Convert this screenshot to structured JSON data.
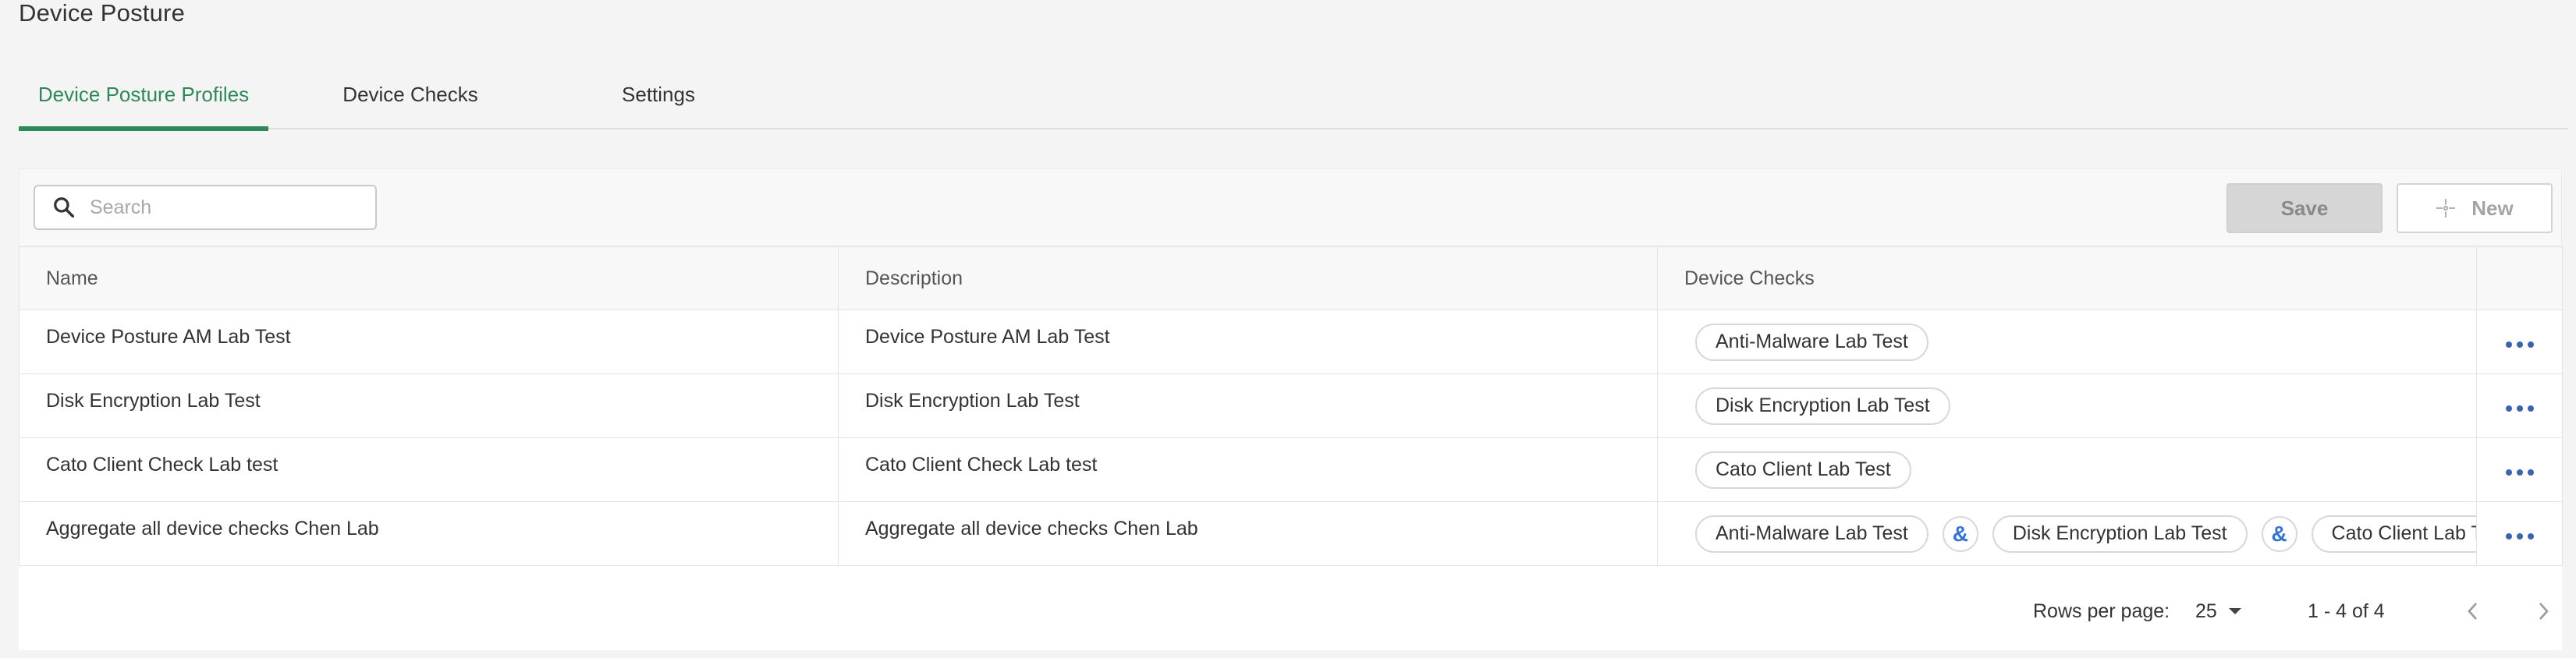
{
  "page_title": "Device Posture",
  "tabs": [
    {
      "label": "Device Posture Profiles",
      "active": true
    },
    {
      "label": "Device Checks",
      "active": false
    },
    {
      "label": "Settings",
      "active": false
    }
  ],
  "toolbar": {
    "search_placeholder": "Search",
    "save_label": "Save",
    "new_label": "New"
  },
  "table": {
    "columns": [
      "Name",
      "Description",
      "Device Checks"
    ],
    "rows": [
      {
        "name": "Device Posture AM Lab Test",
        "description": "Device Posture AM Lab Test",
        "checks": [
          "Anti-Malware Lab Test"
        ]
      },
      {
        "name": "Disk Encryption Lab Test",
        "description": "Disk Encryption Lab Test",
        "checks": [
          "Disk Encryption Lab Test"
        ]
      },
      {
        "name": "Cato Client Check Lab test",
        "description": "Cato Client Check Lab test",
        "checks": [
          "Cato Client Lab Test"
        ]
      },
      {
        "name": "Aggregate all device checks Chen Lab",
        "description": "Aggregate all device checks Chen Lab",
        "checks": [
          "Anti-Malware Lab Test",
          "Disk Encryption Lab Test",
          "Cato Client Lab Test"
        ]
      }
    ],
    "and_symbol": "&"
  },
  "pagination": {
    "rows_per_page_label": "Rows per page:",
    "rows_per_page_value": "25",
    "range_text": "1 - 4 of 4"
  },
  "colors": {
    "accent": "#2b8a57",
    "link_blue": "#2f72d8",
    "menu_dots": "#3a63b0"
  }
}
